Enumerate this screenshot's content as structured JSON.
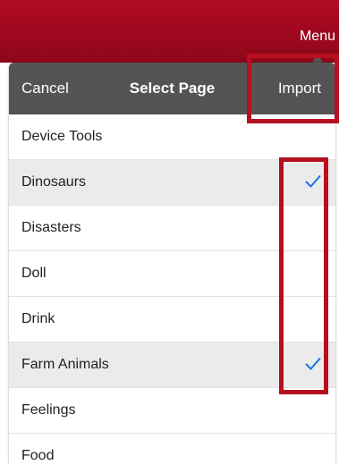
{
  "app_bar": {
    "menu_label": "Menu"
  },
  "nav": {
    "cancel_label": "Cancel",
    "title": "Select Page",
    "import_label": "Import"
  },
  "pages": [
    {
      "label": "Device Tools",
      "selected": false
    },
    {
      "label": "Dinosaurs",
      "selected": true
    },
    {
      "label": "Disasters",
      "selected": false
    },
    {
      "label": "Doll",
      "selected": false
    },
    {
      "label": "Drink",
      "selected": false
    },
    {
      "label": "Farm Animals",
      "selected": true
    },
    {
      "label": "Feelings",
      "selected": false
    },
    {
      "label": "Food",
      "selected": false
    }
  ],
  "colors": {
    "app_bar": "#a00920",
    "nav_bar": "#545454",
    "checkmark": "#1a73e8",
    "selected_row": "#ebebeb",
    "highlight": "#b5101f"
  },
  "icons": {
    "row_selected": "checkmark-icon",
    "popover_pointer": "caret-up-icon"
  }
}
